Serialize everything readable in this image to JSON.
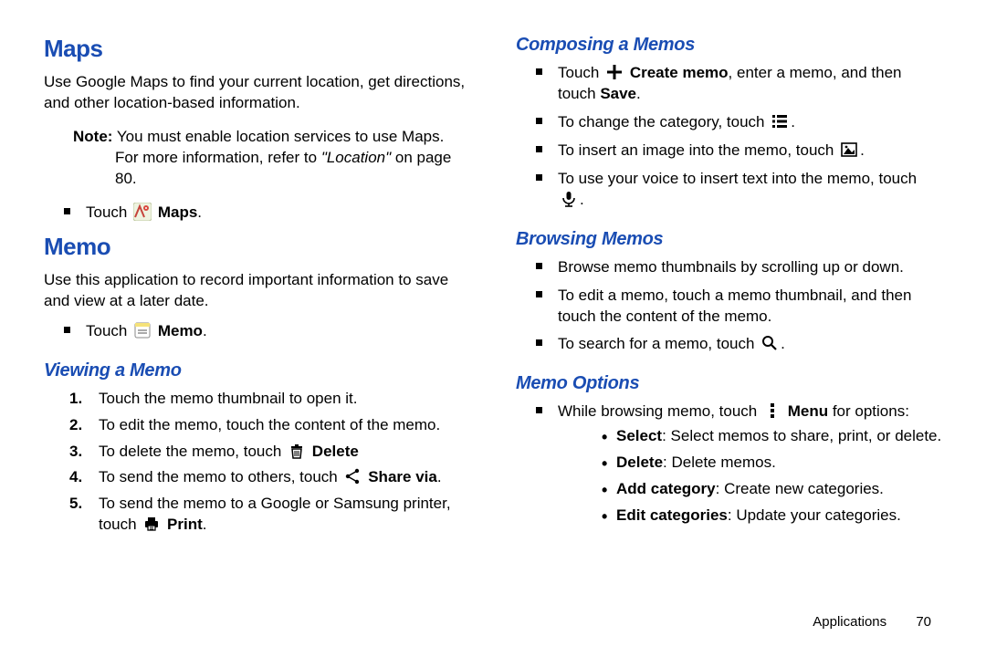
{
  "left": {
    "maps": {
      "heading": "Maps",
      "desc": "Use Google Maps to find your current location, get directions, and other location-based information.",
      "note_label": "Note:",
      "note_a": " You must enable location services to use Maps. For more information, refer to ",
      "note_ref": "\"Location\"",
      "note_b": " on page 80.",
      "touch_a": "Touch ",
      "touch_b": "Maps",
      "touch_c": "."
    },
    "memo": {
      "heading": "Memo",
      "desc": "Use this application to record important information to save and view at a later date.",
      "touch_a": "Touch ",
      "touch_b": "Memo",
      "touch_c": "."
    },
    "viewing": {
      "heading": "Viewing a Memo",
      "s1": "Touch the memo thumbnail to open it.",
      "s2": "To edit the memo, touch the content of the memo.",
      "s3_a": "To delete the memo, touch ",
      "s3_b": "Delete",
      "s4_a": "To send the memo to others, touch ",
      "s4_b": "Share via",
      "s4_c": ".",
      "s5_a": "To send the memo to a Google or Samsung printer, touch ",
      "s5_b": "Print",
      "s5_c": "."
    }
  },
  "right": {
    "composing": {
      "heading": "Composing a Memos",
      "b1_a": "Touch ",
      "b1_b": "Create memo",
      "b1_c": ", enter a memo, and then touch ",
      "b1_d": "Save",
      "b1_e": ".",
      "b2_a": "To change the category, touch ",
      "b2_b": ".",
      "b3_a": "To insert an image into the memo, touch ",
      "b3_b": ".",
      "b4_a": "To use your voice to insert text into the memo, touch ",
      "b4_b": "."
    },
    "browsing": {
      "heading": "Browsing Memos",
      "b1": "Browse memo thumbnails by scrolling up or down.",
      "b2": "To edit a memo, touch a memo thumbnail, and then touch the content of the memo.",
      "b3_a": "To search for a memo, touch ",
      "b3_b": "."
    },
    "options": {
      "heading": "Memo Options",
      "b1_a": "While browsing memo, touch ",
      "b1_b": "Menu",
      "b1_c": " for options:",
      "s1_a": "Select",
      "s1_b": ": Select memos to share, print, or delete.",
      "s2_a": "Delete",
      "s2_b": ": Delete memos.",
      "s3_a": "Add category",
      "s3_b": ": Create new categories.",
      "s4_a": "Edit categories",
      "s4_b": ": Update your categories."
    }
  },
  "footer": {
    "chapter": "Applications",
    "page": "70"
  }
}
